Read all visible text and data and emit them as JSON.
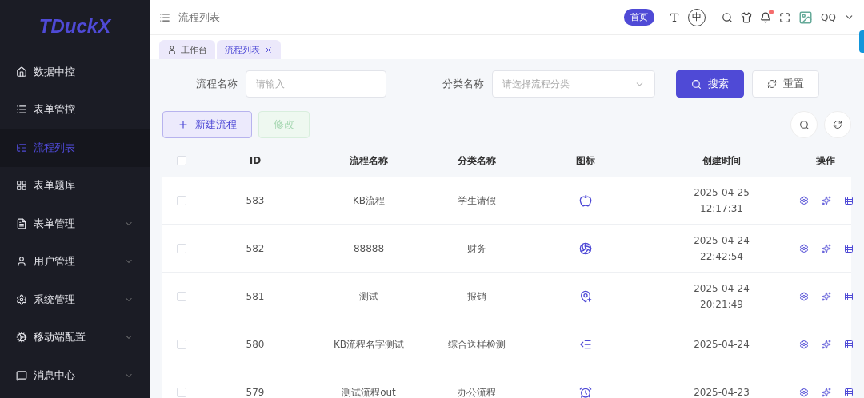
{
  "sidebar": {
    "logo": "TDuckX",
    "items": [
      {
        "label": "数据中控",
        "selected": false,
        "expandable": false
      },
      {
        "label": "表单管控",
        "selected": false,
        "expandable": false
      },
      {
        "label": "流程列表",
        "selected": true,
        "expandable": false
      },
      {
        "label": "表单题库",
        "selected": false,
        "expandable": false
      },
      {
        "label": "表单管理",
        "selected": false,
        "expandable": true
      },
      {
        "label": "用户管理",
        "selected": false,
        "expandable": true
      },
      {
        "label": "系统管理",
        "selected": false,
        "expandable": true
      },
      {
        "label": "移动端配置",
        "selected": false,
        "expandable": true
      },
      {
        "label": "消息中心",
        "selected": false,
        "expandable": true
      }
    ]
  },
  "header": {
    "breadcrumb": "流程列表",
    "home_badge": "首页",
    "lang_icon_text": "中",
    "user": "QQ",
    "notification_dot": true
  },
  "tabs": [
    {
      "label": "工作台",
      "selected": false,
      "closable": false
    },
    {
      "label": "流程列表",
      "selected": true,
      "closable": true
    }
  ],
  "filters": {
    "name_label": "流程名称",
    "name_placeholder": "请输入",
    "category_label": "分类名称",
    "category_placeholder": "请选择流程分类",
    "search_button": "搜索",
    "reset_button": "重置"
  },
  "actions": {
    "create_button": "新建流程",
    "edit_button": "修改",
    "edit_disabled": true
  },
  "table": {
    "select_all_checked": false,
    "columns": [
      "ID",
      "流程名称",
      "分类名称",
      "图标",
      "创建时间",
      "操作"
    ],
    "rows": [
      {
        "id": "583",
        "name": "KB流程",
        "category": "学生请假",
        "time": [
          "2025-04-25",
          "12:17:31"
        ],
        "checked": false
      },
      {
        "id": "582",
        "name": "88888",
        "category": "财务",
        "time": [
          "2025-04-24",
          "22:42:54"
        ],
        "checked": false
      },
      {
        "id": "581",
        "name": "测试",
        "category": "报销",
        "time": [
          "2025-04-24",
          "20:21:49"
        ],
        "checked": false
      },
      {
        "id": "580",
        "name": "KB流程名字测试",
        "category": "综合送样检测",
        "time": [
          "2025-04-24"
        ],
        "checked": false
      },
      {
        "id": "579",
        "name": "测试流程out",
        "category": "办公流程",
        "time": [
          "2025-04-23"
        ],
        "checked": false
      }
    ]
  }
}
